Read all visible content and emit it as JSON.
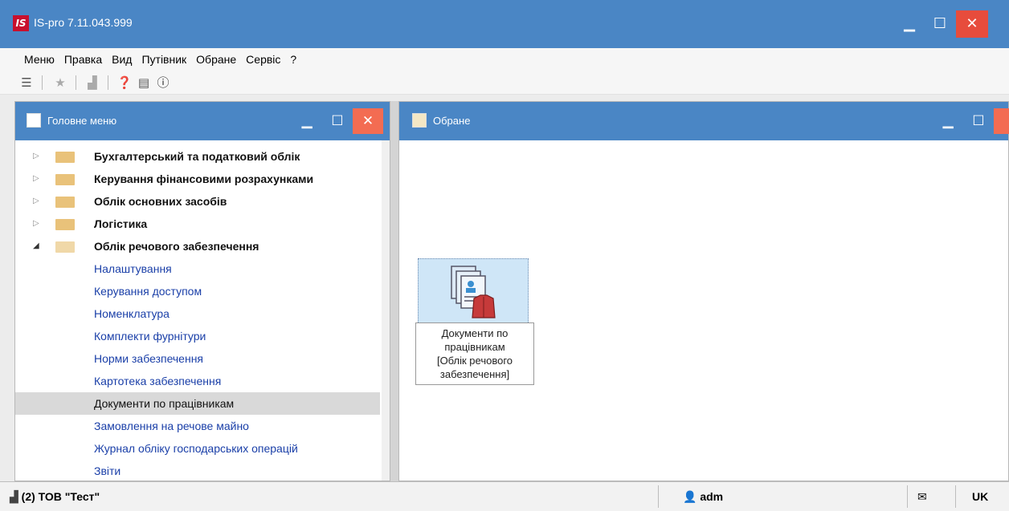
{
  "window": {
    "logo_text": "IS",
    "title": "IS-pro 7.11.043.999",
    "min_icon": "minimize-icon",
    "max_icon": "maximize-icon",
    "close_icon": "close-icon"
  },
  "menu": {
    "items": [
      "Меню",
      "Правка",
      "Вид",
      "Путівник",
      "Обране",
      "Сервіс",
      "?"
    ]
  },
  "toolbar": {
    "icons": [
      "document-icon",
      "star-icon",
      "chart-icon",
      "help-icon",
      "doc-info-icon",
      "info-icon"
    ]
  },
  "left_panel": {
    "title": "Головне меню",
    "tree": [
      {
        "label": "Бухгалтерський та податковий облік",
        "expanded": false
      },
      {
        "label": "Керування фінансовими розрахунками",
        "expanded": false
      },
      {
        "label": "Облік основних засобів",
        "expanded": false
      },
      {
        "label": "Логістика",
        "expanded": false
      },
      {
        "label": "Облік речового забезпечення",
        "expanded": true
      }
    ],
    "children": [
      "Налаштування",
      "Керування доступом",
      "Номенклатура",
      "Комплекти фурнітури",
      "Норми забезпечення",
      "Картотека забезпечення",
      "Документи по працівникам",
      "Замовлення на речове майно",
      "Журнал обліку господарських операцій",
      "Звіти"
    ],
    "selected_child": "Документи по працівникам"
  },
  "right_panel": {
    "title": "Обране",
    "favorite": {
      "line1": "Документи по",
      "line2": "працівникам",
      "line3": "[Облік речового",
      "line4": "забезпечення]"
    }
  },
  "status": {
    "org": "(2) ТОВ \"Тест\"",
    "user": "adm",
    "lang": "UK"
  },
  "colors": {
    "titlebar": "#4a86c5",
    "close": "#e74c3c",
    "link": "#1a3fa8",
    "selection": "#d9d9d9"
  }
}
